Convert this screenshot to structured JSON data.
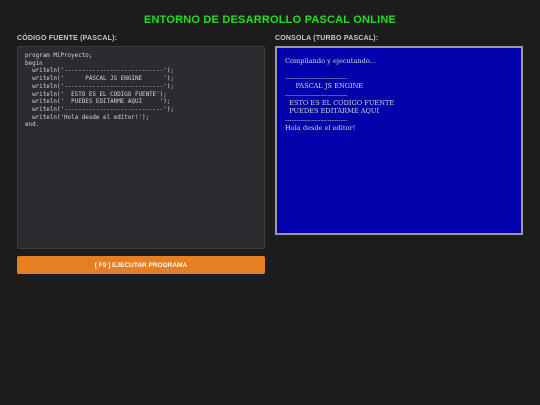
{
  "header": {
    "title": "ENTORNO DE DESARROLLO PASCAL ONLINE"
  },
  "editor": {
    "label": "CÓDIGO FUENTE (PASCAL):",
    "code": "program MiProyecto;\nbegin\n  writeln('----------------------------');\n  writeln('      PASCAL JS ENGINE      ');\n  writeln('----------------------------');\n  writeln('  ESTO ES EL CODIGO FUENTE');\n  writeln('  PUEDES EDITARME AQUI     ');\n  writeln('----------------------------');\n  writeln('Hola desde el editor!');\nend."
  },
  "console": {
    "label": "CONSOLA (TURBO PASCAL):",
    "output": "Compilando y ejecutando...\n\n----------------------------\n     PASCAL JS ENGINE\n----------------------------\n  ESTO ES EL CODIGO FUENTE\n  PUEDES EDITARME AQUI\n----------------------------\nHola desde el editor!"
  },
  "actions": {
    "run_label": "[ F9 ] EJECUTAR PROGRAMA"
  },
  "colors": {
    "title": "#22e01c",
    "console_bg": "#0000aa",
    "button": "#e67e22",
    "page_bg": "#1c1c1c"
  }
}
